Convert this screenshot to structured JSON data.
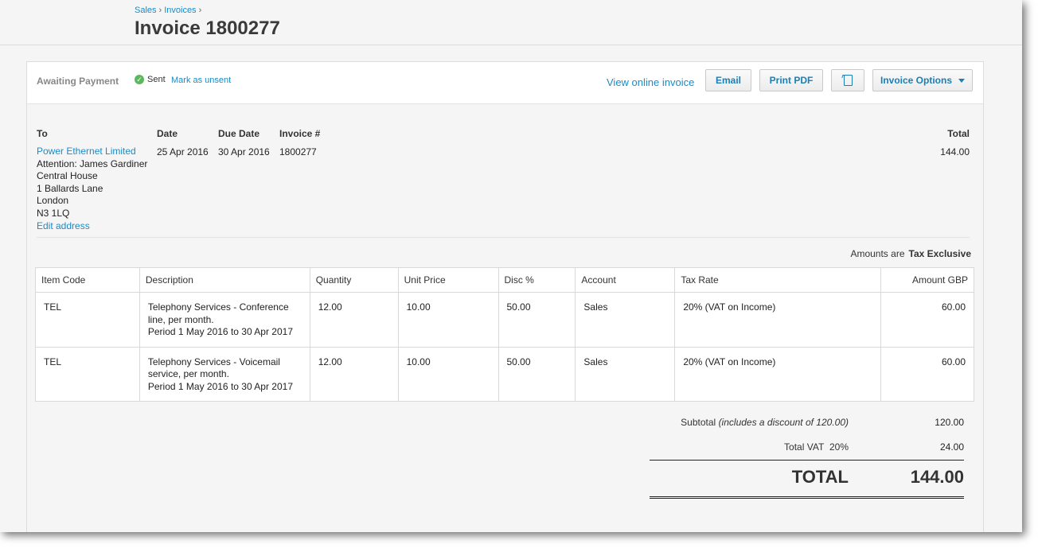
{
  "breadcrumb": {
    "item1": "Sales",
    "item2": "Invoices",
    "sep": "›"
  },
  "page": {
    "title": "Invoice 1800277"
  },
  "toolbar": {
    "status": "Awaiting Payment",
    "sent_label": "Sent",
    "mark_unsent": "Mark as unsent",
    "view_online": "View online invoice",
    "email": "Email",
    "print_pdf": "Print PDF",
    "invoice_options": "Invoice Options"
  },
  "header": {
    "to_label": "To",
    "date_label": "Date",
    "due_label": "Due Date",
    "number_label": "Invoice #",
    "total_label": "Total",
    "date": "25 Apr 2016",
    "due_date": "30 Apr 2016",
    "number": "1800277",
    "total": "144.00"
  },
  "address": {
    "name": "Power Ethernet Limited",
    "attention": "Attention: James Gardiner",
    "line1": "Central House",
    "line2": "1 Ballards Lane",
    "city": "London",
    "postcode": "N3 1LQ",
    "edit": "Edit address"
  },
  "amounts": {
    "prefix": "Amounts are",
    "mode": "Tax Exclusive"
  },
  "columns": [
    "Item Code",
    "Description",
    "Quantity",
    "Unit Price",
    "Disc %",
    "Account",
    "Tax Rate",
    "Amount GBP"
  ],
  "lines": [
    {
      "code": "TEL",
      "desc1": "Telephony Services - Conference",
      "desc2": "line, per month.",
      "desc3": "Period 1 May 2016 to 30 Apr 2017",
      "qty": "12.00",
      "price": "10.00",
      "disc": "50.00",
      "account": "Sales",
      "tax": "20% (VAT on Income)",
      "amount": "60.00"
    },
    {
      "code": "TEL",
      "desc1": "Telephony Services - Voicemail",
      "desc2": "service, per month.",
      "desc3": "Period 1 May 2016 to 30 Apr 2017",
      "qty": "12.00",
      "price": "10.00",
      "disc": "50.00",
      "account": "Sales",
      "tax": "20% (VAT on Income)",
      "amount": "60.00"
    }
  ],
  "totals": {
    "subtotal_label": "Subtotal",
    "subtotal_note": "(includes a discount of 120.00)",
    "subtotal": "120.00",
    "vat_label": "Total VAT",
    "vat_rate": "20%",
    "vat": "24.00",
    "grand_label": "TOTAL",
    "grand": "144.00"
  },
  "colors": {
    "link": "#1a8bc7",
    "sent_check": "#5cb85c"
  },
  "icons": [
    "check-icon",
    "copy-icon",
    "caret-down-icon"
  ]
}
